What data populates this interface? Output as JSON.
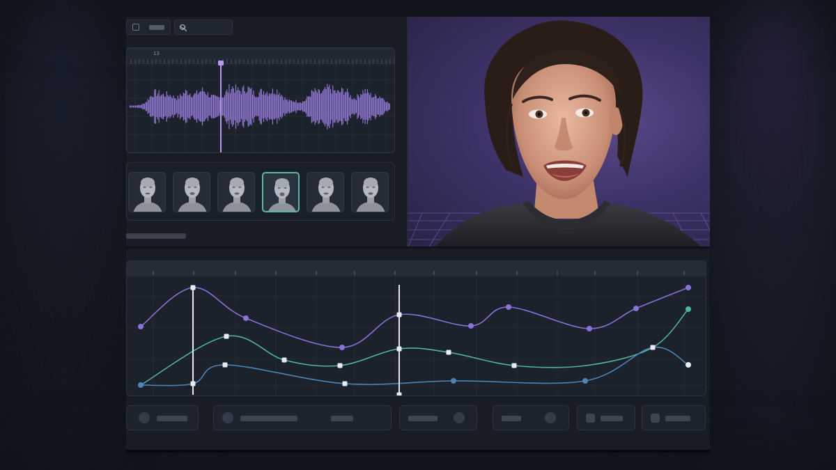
{
  "toolbar": {
    "view_toggle": "view-toggle",
    "search_icon": "search-icon",
    "dropdown_icon": "chevron-down-icon"
  },
  "waveform": {
    "ruler_labels": [
      "13"
    ],
    "playhead_color": "#b79cf0",
    "wave_color": "#9b7fe0"
  },
  "face_strip": {
    "count": 6,
    "selected_index": 3,
    "selected_color": "#5fb7a8"
  },
  "curve_editor": {
    "colors": {
      "series_a": "#8a72d8",
      "series_b": "#4fb3a6",
      "series_c": "#4a86b8",
      "keyframe": "#e8ecf2"
    }
  },
  "colors": {
    "accent": "#8a72d8",
    "teal": "#5fb7a8",
    "panel": "#1c222b",
    "background": "#10141b"
  }
}
